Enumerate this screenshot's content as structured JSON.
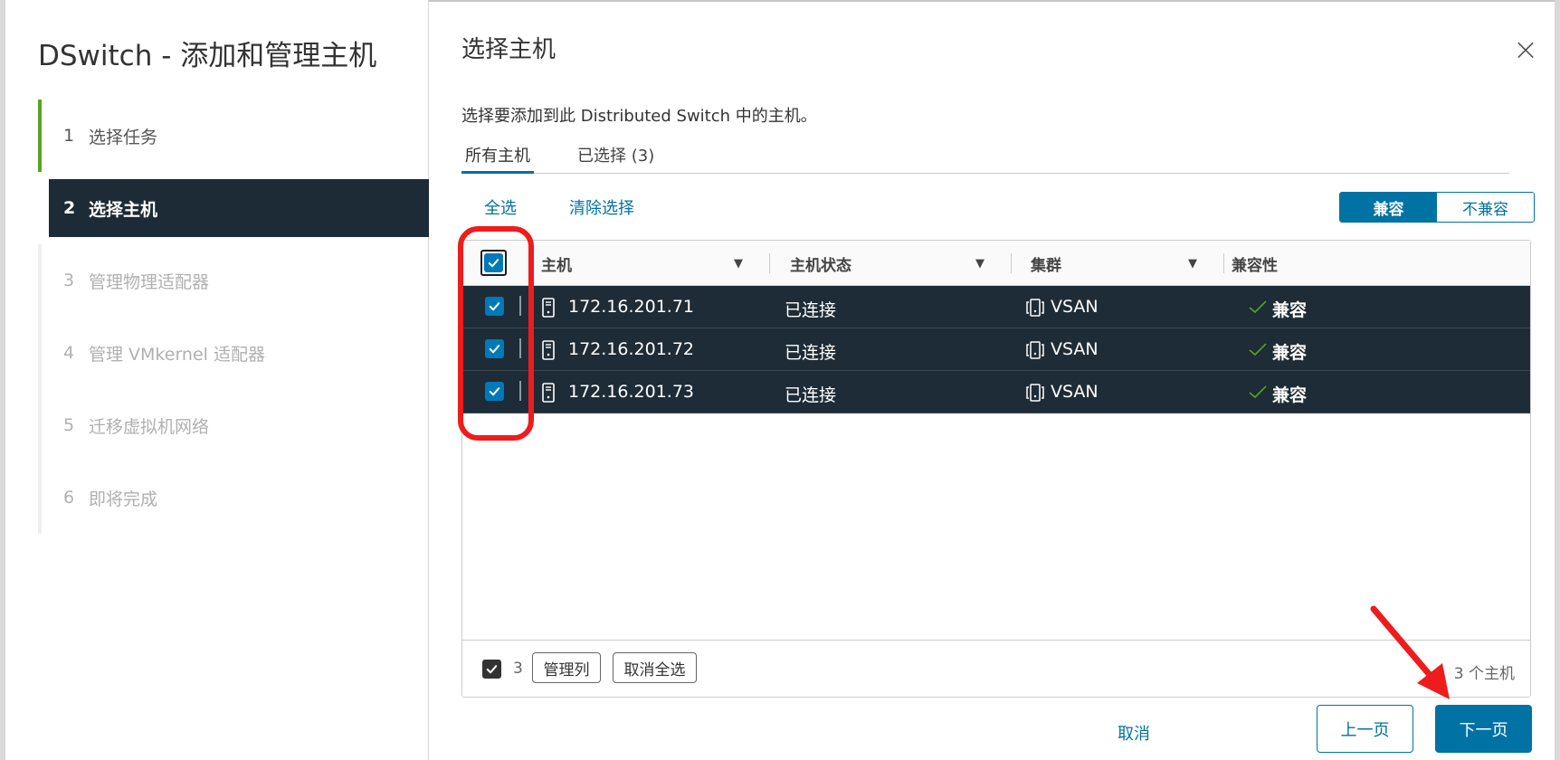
{
  "colors": {
    "accent": "#0072a3",
    "selected_row_bg": "#1e2c37",
    "progress_done": "#5aa220",
    "compatible_check": "#5aa220",
    "annotation_red": "#ee1c1c"
  },
  "wizard": {
    "title": "DSwitch - 添加和管理主机",
    "steps": [
      {
        "num": "1",
        "label": "选择任务",
        "state": "done"
      },
      {
        "num": "2",
        "label": "选择主机",
        "state": "active"
      },
      {
        "num": "3",
        "label": "管理物理适配器",
        "state": "future"
      },
      {
        "num": "4",
        "label": "管理 VMkernel 适配器",
        "state": "future"
      },
      {
        "num": "5",
        "label": "迁移虚拟机网络",
        "state": "future"
      },
      {
        "num": "6",
        "label": "即将完成",
        "state": "future"
      }
    ]
  },
  "main": {
    "title": "选择主机",
    "close_icon": "close-icon",
    "description": "选择要添加到此 Distributed Switch 中的主机。",
    "tabs": [
      {
        "label": "所有主机",
        "active": true
      },
      {
        "label": "已选择 (3)",
        "active": false
      }
    ],
    "links": {
      "select_all": "全选",
      "clear_selection": "清除选择"
    },
    "toggle": {
      "compatible": "兼容",
      "incompatible": "不兼容",
      "selected": "兼容"
    }
  },
  "grid": {
    "columns": [
      {
        "label": "主机"
      },
      {
        "label": "主机状态"
      },
      {
        "label": "集群"
      },
      {
        "label": "兼容性"
      }
    ],
    "rows": [
      {
        "host": "172.16.201.71",
        "status": "已连接",
        "cluster": "VSAN",
        "compat": "兼容",
        "selected": true
      },
      {
        "host": "172.16.201.72",
        "status": "已连接",
        "cluster": "VSAN",
        "compat": "兼容",
        "selected": true
      },
      {
        "host": "172.16.201.73",
        "status": "已连接",
        "cluster": "VSAN",
        "compat": "兼容",
        "selected": true
      }
    ],
    "footer": {
      "selected_count": "3",
      "manage_columns": "管理列",
      "deselect_all": "取消全选",
      "total": "3 个主机"
    }
  },
  "actions": {
    "cancel": "取消",
    "back": "上一页",
    "next": "下一页"
  }
}
